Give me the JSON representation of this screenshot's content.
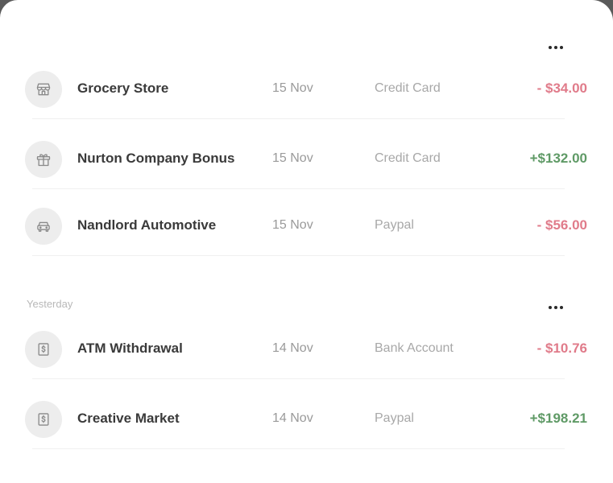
{
  "colors": {
    "negative": "#e07b8a",
    "positive": "#5f9a66",
    "muted": "#a8a8a8",
    "icon_bg": "#ededed"
  },
  "groups": [
    {
      "label": "",
      "transactions": [
        {
          "icon": "store-icon",
          "name": "Grocery Store",
          "date": "15 Nov",
          "method": "Credit Card",
          "amount": "- $34.00",
          "direction": "out"
        },
        {
          "icon": "gift-icon",
          "name": "Nurton Company Bonus",
          "date": "15 Nov",
          "method": "Credit Card",
          "amount": "+$132.00",
          "direction": "in"
        },
        {
          "icon": "car-icon",
          "name": "Nandlord Automotive",
          "date": "15 Nov",
          "method": "Paypal",
          "amount": "- $56.00",
          "direction": "out"
        }
      ]
    },
    {
      "label": "Yesterday",
      "transactions": [
        {
          "icon": "dollar-bill-icon",
          "name": "ATM Withdrawal",
          "date": "14 Nov",
          "method": "Bank Account",
          "amount": "- $10.76",
          "direction": "out"
        },
        {
          "icon": "dollar-bill-icon",
          "name": "Creative Market",
          "date": "14 Nov",
          "method": "Paypal",
          "amount": "+$198.21",
          "direction": "in"
        }
      ]
    }
  ]
}
